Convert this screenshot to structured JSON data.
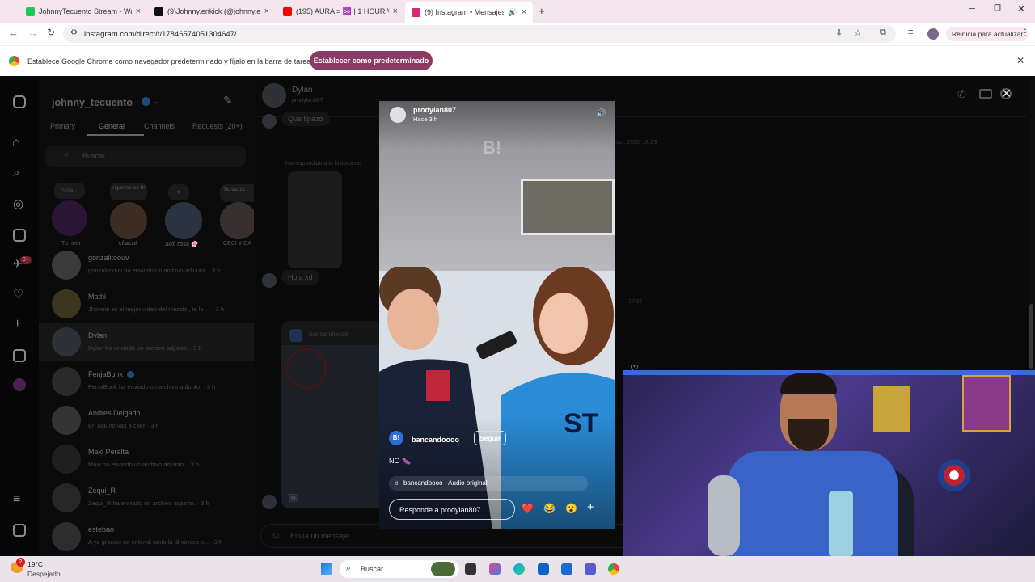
{
  "browser": {
    "tabs": [
      {
        "title": "JohnnyTecuento Stream - Watc",
        "color": "#22c55e"
      },
      {
        "title": "(9)Johnny.enkick (@johnny.enk",
        "color": "#111111"
      },
      {
        "title": "(195) AURA = ♾️ | 1 HOUR VII",
        "color": "#ff0000"
      },
      {
        "title": "(9) Instagram • Mensajes",
        "color": "#d62976"
      }
    ],
    "url": "instagram.com/direct/t/17846574051304647/",
    "update_button": "Reinicia para actualizar",
    "infobar_text": "Establece Google Chrome como navegador predeterminado y fíjalo en la barra de tareas",
    "infobar_button": "Establecer como predeterminado"
  },
  "instagram": {
    "username": "johnny_tecuento",
    "tabs": [
      "Primary",
      "General",
      "Channels",
      "Requests (20+)"
    ],
    "search_placeholder": "Buscar",
    "rail_badge": "9+",
    "notes": [
      {
        "bubble": "Nota...",
        "label": "Tu nota"
      },
      {
        "bubble": "siganme en B!",
        "label": "chachi"
      },
      {
        "bubble": "♥",
        "label": "Sofi rosa 🌸"
      },
      {
        "bubble": "Tic tac tic t",
        "label": "CECI VIDA"
      }
    ],
    "threads": [
      {
        "name": "gonzalitoouv",
        "sub": "gonzalitoouv ha enviado un archivo adjunto. · 3 h"
      },
      {
        "name": "Mathi",
        "sub": "Jhonnie es el mejor video del mundo , te lo ... · 3 h"
      },
      {
        "name": "Dylan",
        "sub": "Dylan ha enviado un archivo adjunto. · 3 h"
      },
      {
        "name": "FenjaBunk",
        "sub": "FenjaBunk ha enviado un archivo adjunto. · 3 h"
      },
      {
        "name": "Andres Delgado",
        "sub": "En alguno vas a caer · 3 h"
      },
      {
        "name": "Maxi Peralta",
        "sub": "Maxi ha enviado un archivo adjunto. · 3 h"
      },
      {
        "name": "Zequi_R",
        "sub": "Zequi_R ha enviado un archivo adjunto. · 3 h"
      },
      {
        "name": "esteban",
        "sub": "A ya gracias no entendi tanto la dinámica p... · 3 h"
      }
    ],
    "chat": {
      "name": "Dylan",
      "handle": "prodylan807",
      "msg1": "Que tipazo",
      "replied": "Ha respondido a la historia de",
      "msg2": "Hola xd",
      "date": "oct. 2025, 18:29",
      "time2": "17:37",
      "shared_account": "bancandoooo",
      "input_placeholder": "Envía un mensaje..."
    },
    "story": {
      "user": "prodylan807",
      "time": "Hace 3 h",
      "account": "bancandoooo",
      "follow": "Seguir",
      "caption": "NO 🍆",
      "audio": "bancandoooo · Audio original",
      "reply_placeholder": "Responde a prodylan807...",
      "reactions": [
        "❤️",
        "😂",
        "😮"
      ]
    }
  },
  "taskbar": {
    "weather_temp": "19°C",
    "weather_desc": "Despejado",
    "weather_badge": "2",
    "search": "Buscar"
  }
}
